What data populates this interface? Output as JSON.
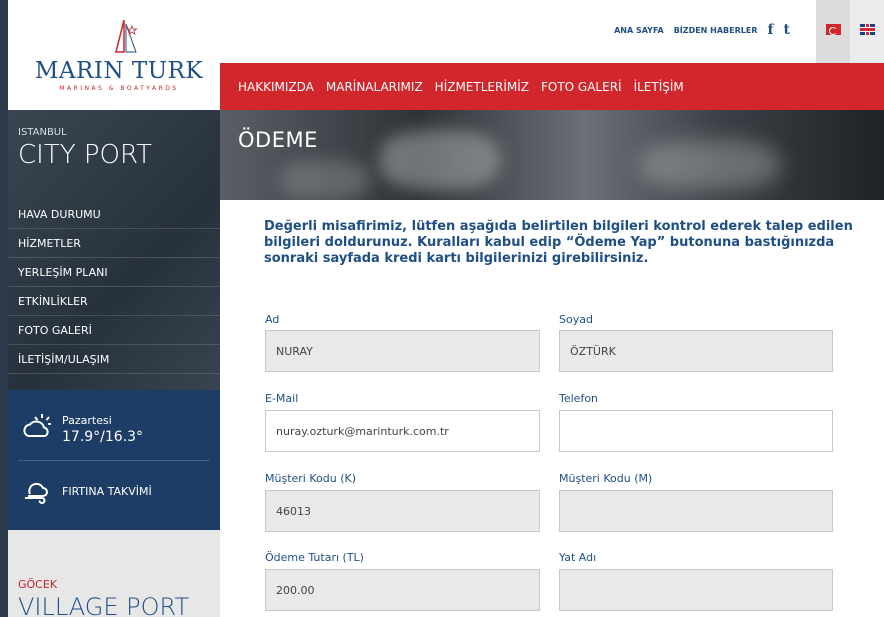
{
  "logo": {
    "brand": "MARIN TURK",
    "subtitle": "MARINAS & BOATYARDS"
  },
  "top_links": {
    "home": "ANA SAYFA",
    "news": "BİZDEN HABERLER",
    "facebook": "f",
    "twitter": "t"
  },
  "languages": [
    "tr",
    "en"
  ],
  "nav": [
    "HAKKIMIZDA",
    "MARİNALARIMIZ",
    "HİZMETLERİMİZ",
    "FOTO GALERİ",
    "İLETİŞİM"
  ],
  "sidebar": {
    "city_small": "ISTANBUL",
    "city_big": "CITY PORT",
    "menu": [
      "HAVA DURUMU",
      "HİZMETLER",
      "YERLEŞİM PLANI",
      "ETKİNLİKLER",
      "FOTO GALERİ",
      "İLETİŞİM/ULAŞIM"
    ],
    "weather_day": "Pazartesi",
    "weather_temp": "17.9°/16.3°",
    "storm_label": "FIRTINA TAKVİMİ",
    "village_small": "GÖCEK",
    "village_big": "VILLAGE PORT"
  },
  "page": {
    "title": "ÖDEME",
    "intro": "Değerli misafirimiz, lütfen aşağıda belirtilen bilgileri kontrol ederek talep edilen bilgileri doldurunuz. Kuralları kabul edip “Ödeme Yap” butonuna bastığınızda sonraki sayfada kredi kartı bilgilerinizi girebilirsiniz."
  },
  "form": {
    "ad": {
      "label": "Ad",
      "value": "NURAY"
    },
    "soyad": {
      "label": "Soyad",
      "value": "ÖZTÜRK"
    },
    "email": {
      "label": "E-Mail",
      "value": "nuray.ozturk@marinturk.com.tr"
    },
    "telefon": {
      "label": "Telefon",
      "value": ""
    },
    "musteri_k": {
      "label": "Müşteri Kodu (K)",
      "value": "46013"
    },
    "musteri_m": {
      "label": "Müşteri Kodu (M)",
      "value": ""
    },
    "tutar": {
      "label": "Ödeme Tutarı (TL)",
      "value": "200.00"
    },
    "yat": {
      "label": "Yat Adı",
      "value": ""
    }
  }
}
